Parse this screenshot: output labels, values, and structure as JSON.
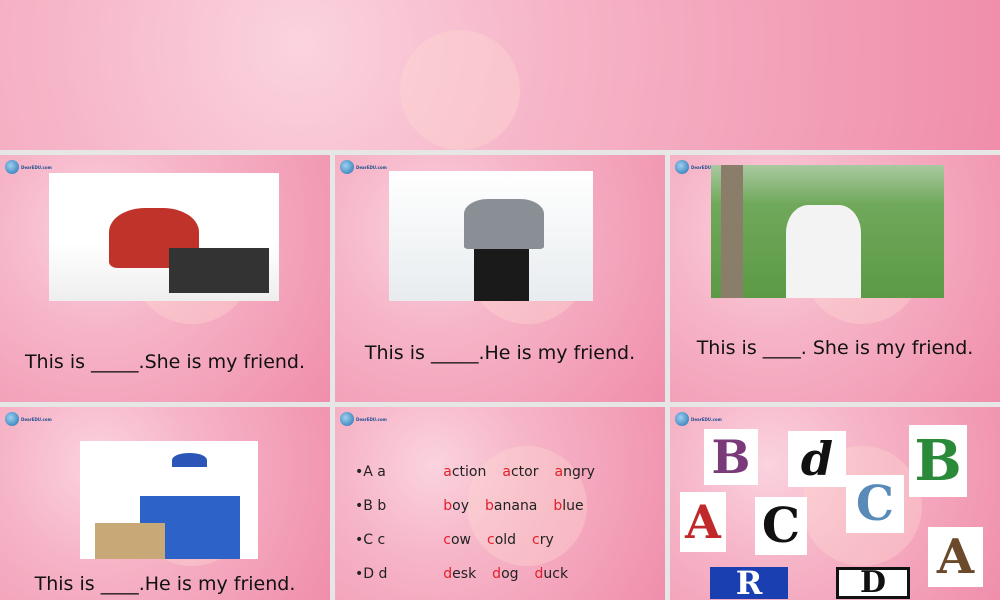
{
  "slides": [
    {
      "caption": ""
    },
    {
      "caption": "This is _____.She is my friend.",
      "logo": "DearEDU.com"
    },
    {
      "caption": "This is _____.He is my friend.",
      "logo": "DearEDU.com"
    },
    {
      "caption": "This is ____. She is my friend.",
      "logo": "DearEDU.com"
    },
    {
      "caption": "This is ____.He is my friend.",
      "logo": "DearEDU.com"
    },
    {
      "logo": "DearEDU.com",
      "rows": [
        {
          "letter": "A a",
          "words": [
            [
              "a",
              "ction"
            ],
            [
              "a",
              "ctor"
            ],
            [
              "a",
              "ngry"
            ]
          ]
        },
        {
          "letter": "B b",
          "words": [
            [
              "b",
              "oy"
            ],
            [
              "b",
              "anana"
            ],
            [
              "b",
              "lue"
            ]
          ]
        },
        {
          "letter": "C c",
          "words": [
            [
              "c",
              "ow"
            ],
            [
              "c",
              "old"
            ],
            [
              "c",
              "ry"
            ]
          ]
        },
        {
          "letter": "D d",
          "words": [
            [
              "d",
              "esk"
            ],
            [
              "d",
              "og"
            ],
            [
              "d",
              "uck"
            ]
          ]
        }
      ]
    },
    {
      "logo": "DearEDU.com",
      "letters": [
        "B",
        "d",
        "B",
        "A",
        "C",
        "C",
        "A",
        "R",
        "D"
      ]
    }
  ]
}
